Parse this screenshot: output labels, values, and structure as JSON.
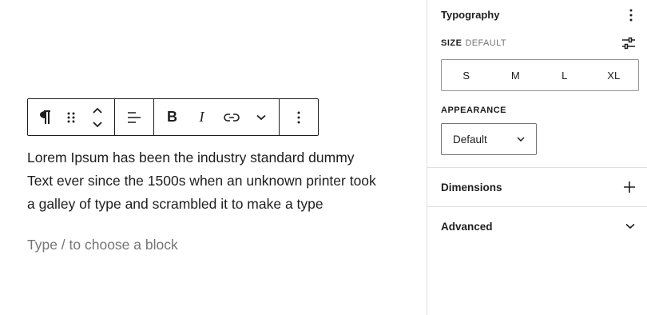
{
  "editor": {
    "toolbar": {
      "paragraph": "paragraph-icon",
      "drag": "drag-handle-icon",
      "move": "move-up-down-icon",
      "align": "align-left-icon",
      "bold": "B",
      "italic": "I",
      "link": "link-icon",
      "more": "chevron-down-icon",
      "options": "vertical-ellipsis-icon"
    },
    "paragraph_lines": [
      "Lorem Ipsum has been the industry standard dummy",
      "Text ever since the 1500s when an unknown printer took",
      "a galley of type and scrambled it to make a type"
    ],
    "placeholder": "Type / to choose a block"
  },
  "sidebar": {
    "typography": {
      "title": "Typography",
      "size_label": "SIZE",
      "size_value": "DEFAULT",
      "sizes": [
        "S",
        "M",
        "L",
        "XL"
      ],
      "appearance_label": "APPEARANCE",
      "appearance_value": "Default"
    },
    "dimensions": {
      "title": "Dimensions"
    },
    "advanced": {
      "title": "Advanced"
    }
  },
  "colors": {
    "text": "#1e1e1e",
    "muted": "#757575",
    "border": "#e0e0e0"
  }
}
